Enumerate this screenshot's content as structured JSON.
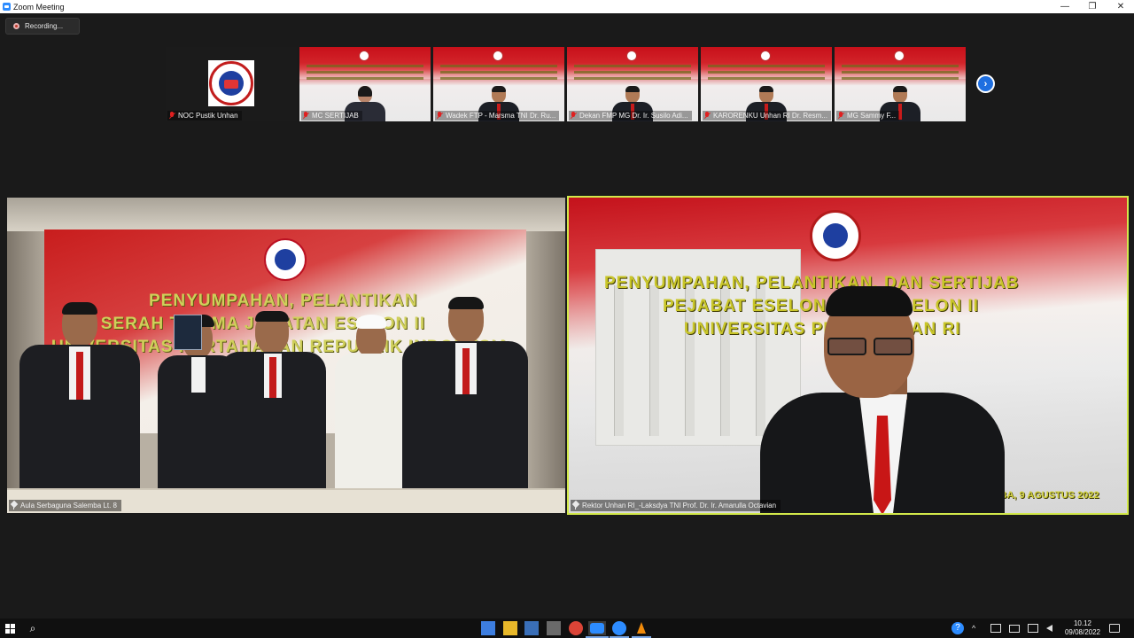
{
  "window": {
    "title": "Zoom Meeting",
    "minimize": "—",
    "maximize": "❐",
    "close": "✕"
  },
  "recording": {
    "label": "Recording..."
  },
  "thumbnails": [
    {
      "name": "NOC Pustik Unhan"
    },
    {
      "name": "MC SERTIJAB"
    },
    {
      "name": "Wadek FTP - Marsma TNI Dr. Ru..."
    },
    {
      "name": "Dekan FMP MG Dr. Ir. Susilo Adi..."
    },
    {
      "name": "KARORENKU Unhan RI Dr. Resm..."
    },
    {
      "name": "MG Sammy F..."
    }
  ],
  "next_button": {
    "icon": "›"
  },
  "main_left": {
    "label": "Aula Serbaguna Salemba Lt. 8",
    "banner_lines": [
      "PENYUMPAHAN, PELANTIKAN",
      "AN SERAH TERIMA JABATAN ESELON II",
      "UNIVERSITAS PERTAHANAN REPUBLIK INDONESIA"
    ]
  },
  "main_right": {
    "label": "Rektor Unhan RI_-Laksdya TNI Prof. Dr. Ir. Amarulla Octavian",
    "banner_lines": [
      "PENYUMPAHAN, PELANTIKAN, DAN SERTIJAB",
      "PEJABAT ESELON I DAN ESELON II",
      "UNIVERSITAS PERTAHANAN RI"
    ],
    "date": "SALEMBA, 9 AGUSTUS 2022"
  },
  "taskbar": {
    "search_icon": "⌕",
    "tray_chevron": "^",
    "clock_time": "10.12",
    "clock_date": "09/08/2022"
  }
}
